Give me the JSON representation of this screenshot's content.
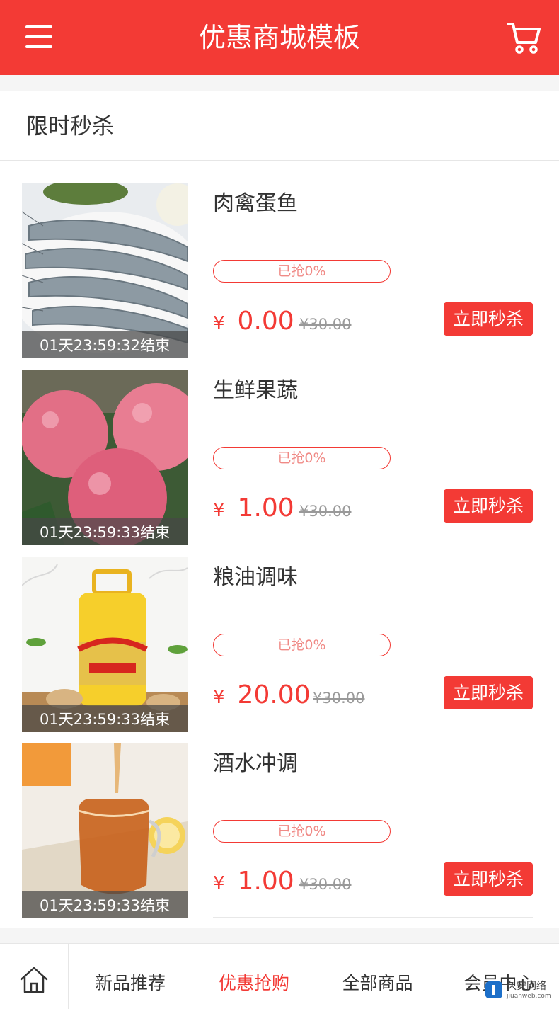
{
  "header": {
    "title": "优惠商城模板",
    "menu_icon": "menu-icon",
    "cart_icon": "cart-icon"
  },
  "section": {
    "title": "限时秒杀"
  },
  "items": [
    {
      "name": "肉禽蛋鱼",
      "countdown": "01天23:59:32结束",
      "progress": "已抢0%",
      "progress_value": 0,
      "currency": "¥",
      "price": "0.00",
      "original_price": "¥30.00",
      "button": "立即秒杀",
      "image": "shrimp"
    },
    {
      "name": "生鲜果蔬",
      "countdown": "01天23:59:33结束",
      "progress": "已抢0%",
      "progress_value": 0,
      "currency": "¥",
      "price": "1.00",
      "original_price": "¥30.00",
      "button": "立即秒杀",
      "image": "apples"
    },
    {
      "name": "粮油调味",
      "countdown": "01天23:59:33结束",
      "progress": "已抢0%",
      "progress_value": 0,
      "currency": "¥",
      "price": "20.00",
      "original_price": "¥30.00",
      "button": "立即秒杀",
      "image": "oil"
    },
    {
      "name": "酒水冲调",
      "countdown": "01天23:59:33结束",
      "progress": "已抢0%",
      "progress_value": 0,
      "currency": "¥",
      "price": "1.00",
      "original_price": "¥30.00",
      "button": "立即秒杀",
      "image": "tea"
    }
  ],
  "bottom_nav": {
    "home_icon": "home-icon",
    "items": [
      {
        "label": "新品推荐",
        "active": false
      },
      {
        "label": "优惠抢购",
        "active": true
      },
      {
        "label": "全部商品",
        "active": false
      },
      {
        "label": "会员中心",
        "active": false
      }
    ]
  },
  "colors": {
    "brand": "#f33a35",
    "text": "#333333",
    "muted": "#999999"
  },
  "watermark": {
    "text": "久安网络",
    "sub": "jiuanweb.com"
  }
}
